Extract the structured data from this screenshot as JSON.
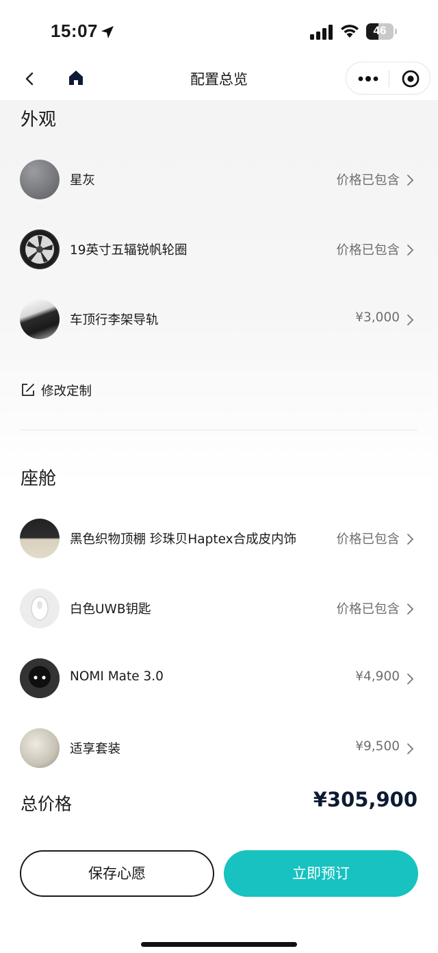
{
  "status_bar": {
    "time": "15:07",
    "battery": "46",
    "battery_level": 0.46
  },
  "nav": {
    "title": "配置总览"
  },
  "exterior": {
    "title": "外观",
    "items": [
      {
        "label": "星灰",
        "value": "价格已包含",
        "thumb": "grey-paint-swatch"
      },
      {
        "label": "19英寸五辐锐帆轮圈",
        "value": "价格已包含",
        "thumb": "wheel-rim"
      },
      {
        "label": "车顶行李架导轨",
        "value": "¥3,000",
        "thumb": "roof-rail"
      }
    ],
    "modify_label": "修改定制"
  },
  "cabin": {
    "title": "座舱",
    "items": [
      {
        "label": "黑色织物顶棚 珍珠贝Haptex合成皮内饰",
        "value": "价格已包含",
        "thumb": "interior-swatch"
      },
      {
        "label": "白色UWB钥匙",
        "value": "价格已包含",
        "thumb": "uwb-key"
      },
      {
        "label": "NOMI Mate 3.0",
        "value": "¥4,900",
        "thumb": "nomi-robot"
      },
      {
        "label": "适享套装",
        "value": "¥9,500",
        "thumb": "seat-package"
      }
    ]
  },
  "summary": {
    "total_label": "总价格",
    "total_value": "¥305,900"
  },
  "actions": {
    "save_label": "保存心愿",
    "order_label": "立即预订"
  },
  "colors": {
    "accent": "#17c2c0",
    "price_dark": "#0c1b33",
    "muted_text": "#6e6e6e"
  }
}
